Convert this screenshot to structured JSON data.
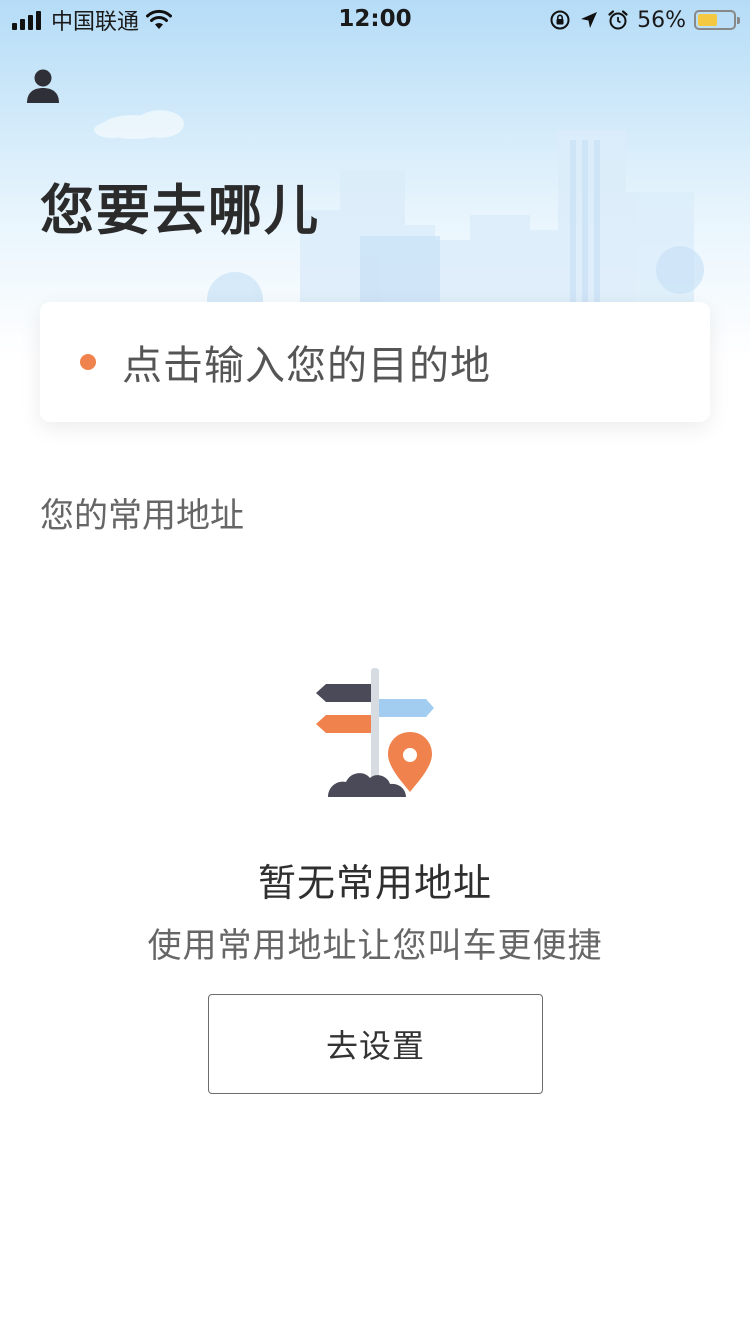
{
  "status_bar": {
    "carrier": "中国联通",
    "time": "12:00",
    "battery_percent": "56%",
    "battery_level": 0.56,
    "battery_color": "#f5c842",
    "icons": [
      "signal-icon",
      "wifi-icon",
      "rotation-lock-icon",
      "location-arrow-icon",
      "alarm-icon",
      "battery-icon"
    ]
  },
  "header": {
    "user_icon": "user-icon",
    "title": "您要去哪儿"
  },
  "search": {
    "placeholder": "点击输入您的目的地",
    "dot_color": "#f0834d"
  },
  "common_addresses": {
    "section_title": "您的常用地址",
    "empty_icon": "signpost-location-icon",
    "empty_title": "暂无常用地址",
    "empty_subtitle": "使用常用地址让您叫车更便捷",
    "setup_button_label": "去设置"
  },
  "colors": {
    "accent_orange": "#f0834d",
    "sign_blue": "#a3cdf0",
    "sign_dark": "#4a4a58"
  }
}
